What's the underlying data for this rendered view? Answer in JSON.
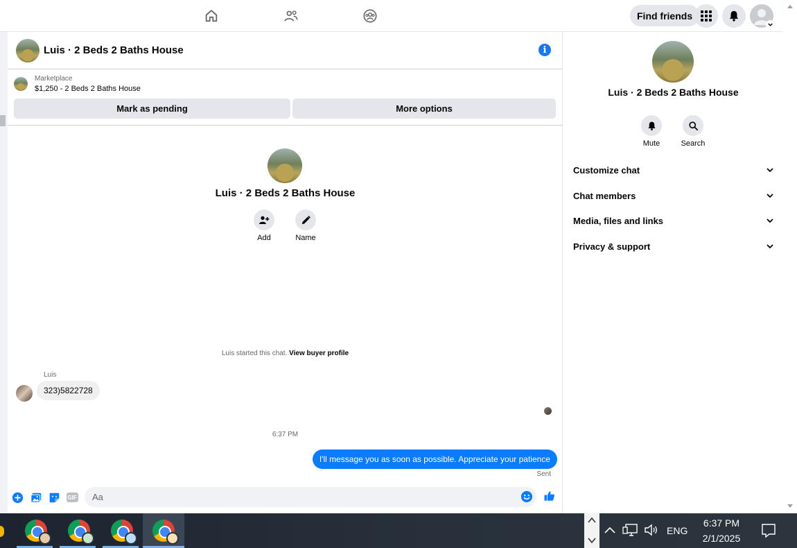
{
  "topnav": {
    "find_friends_label": "Find friends",
    "icons": [
      "home-icon",
      "friends-icon",
      "groups-icon",
      "apps-grid-icon",
      "bell-icon",
      "profile-avatar"
    ]
  },
  "chat": {
    "header_title": "Luis · 2 Beds 2 Baths House",
    "marketplace": {
      "label": "Marketplace",
      "listing": "$1,250 - 2 Beds 2 Baths House",
      "mark_pending_label": "Mark as pending",
      "more_options_label": "More options"
    },
    "intro": {
      "name": "Luis · 2 Beds 2 Baths House",
      "add_label": "Add",
      "name_label": "Name"
    },
    "system_message": {
      "text": "Luis started this chat.",
      "link": "View buyer profile"
    },
    "incoming": {
      "sender": "Luis",
      "text": "323)5822728"
    },
    "time_separator": "6:37 PM",
    "outgoing": {
      "text": "I'll message you as soon as possible. Appreciate your patience",
      "status": "Sent"
    },
    "composer": {
      "placeholder": "Aa",
      "gif_label": "GIF"
    }
  },
  "right_panel": {
    "name": "Luis · 2 Beds 2 Baths House",
    "mute_label": "Mute",
    "search_label": "Search",
    "sections": [
      "Customize chat",
      "Chat members",
      "Media, files and links",
      "Privacy & support"
    ]
  },
  "taskbar": {
    "language": "ENG",
    "time": "6:37 PM",
    "date": "2/1/2025"
  },
  "colors": {
    "accent_blue": "#0a7cff",
    "fb_blue": "#1877f2",
    "button_grey": "#e4e6eb"
  }
}
